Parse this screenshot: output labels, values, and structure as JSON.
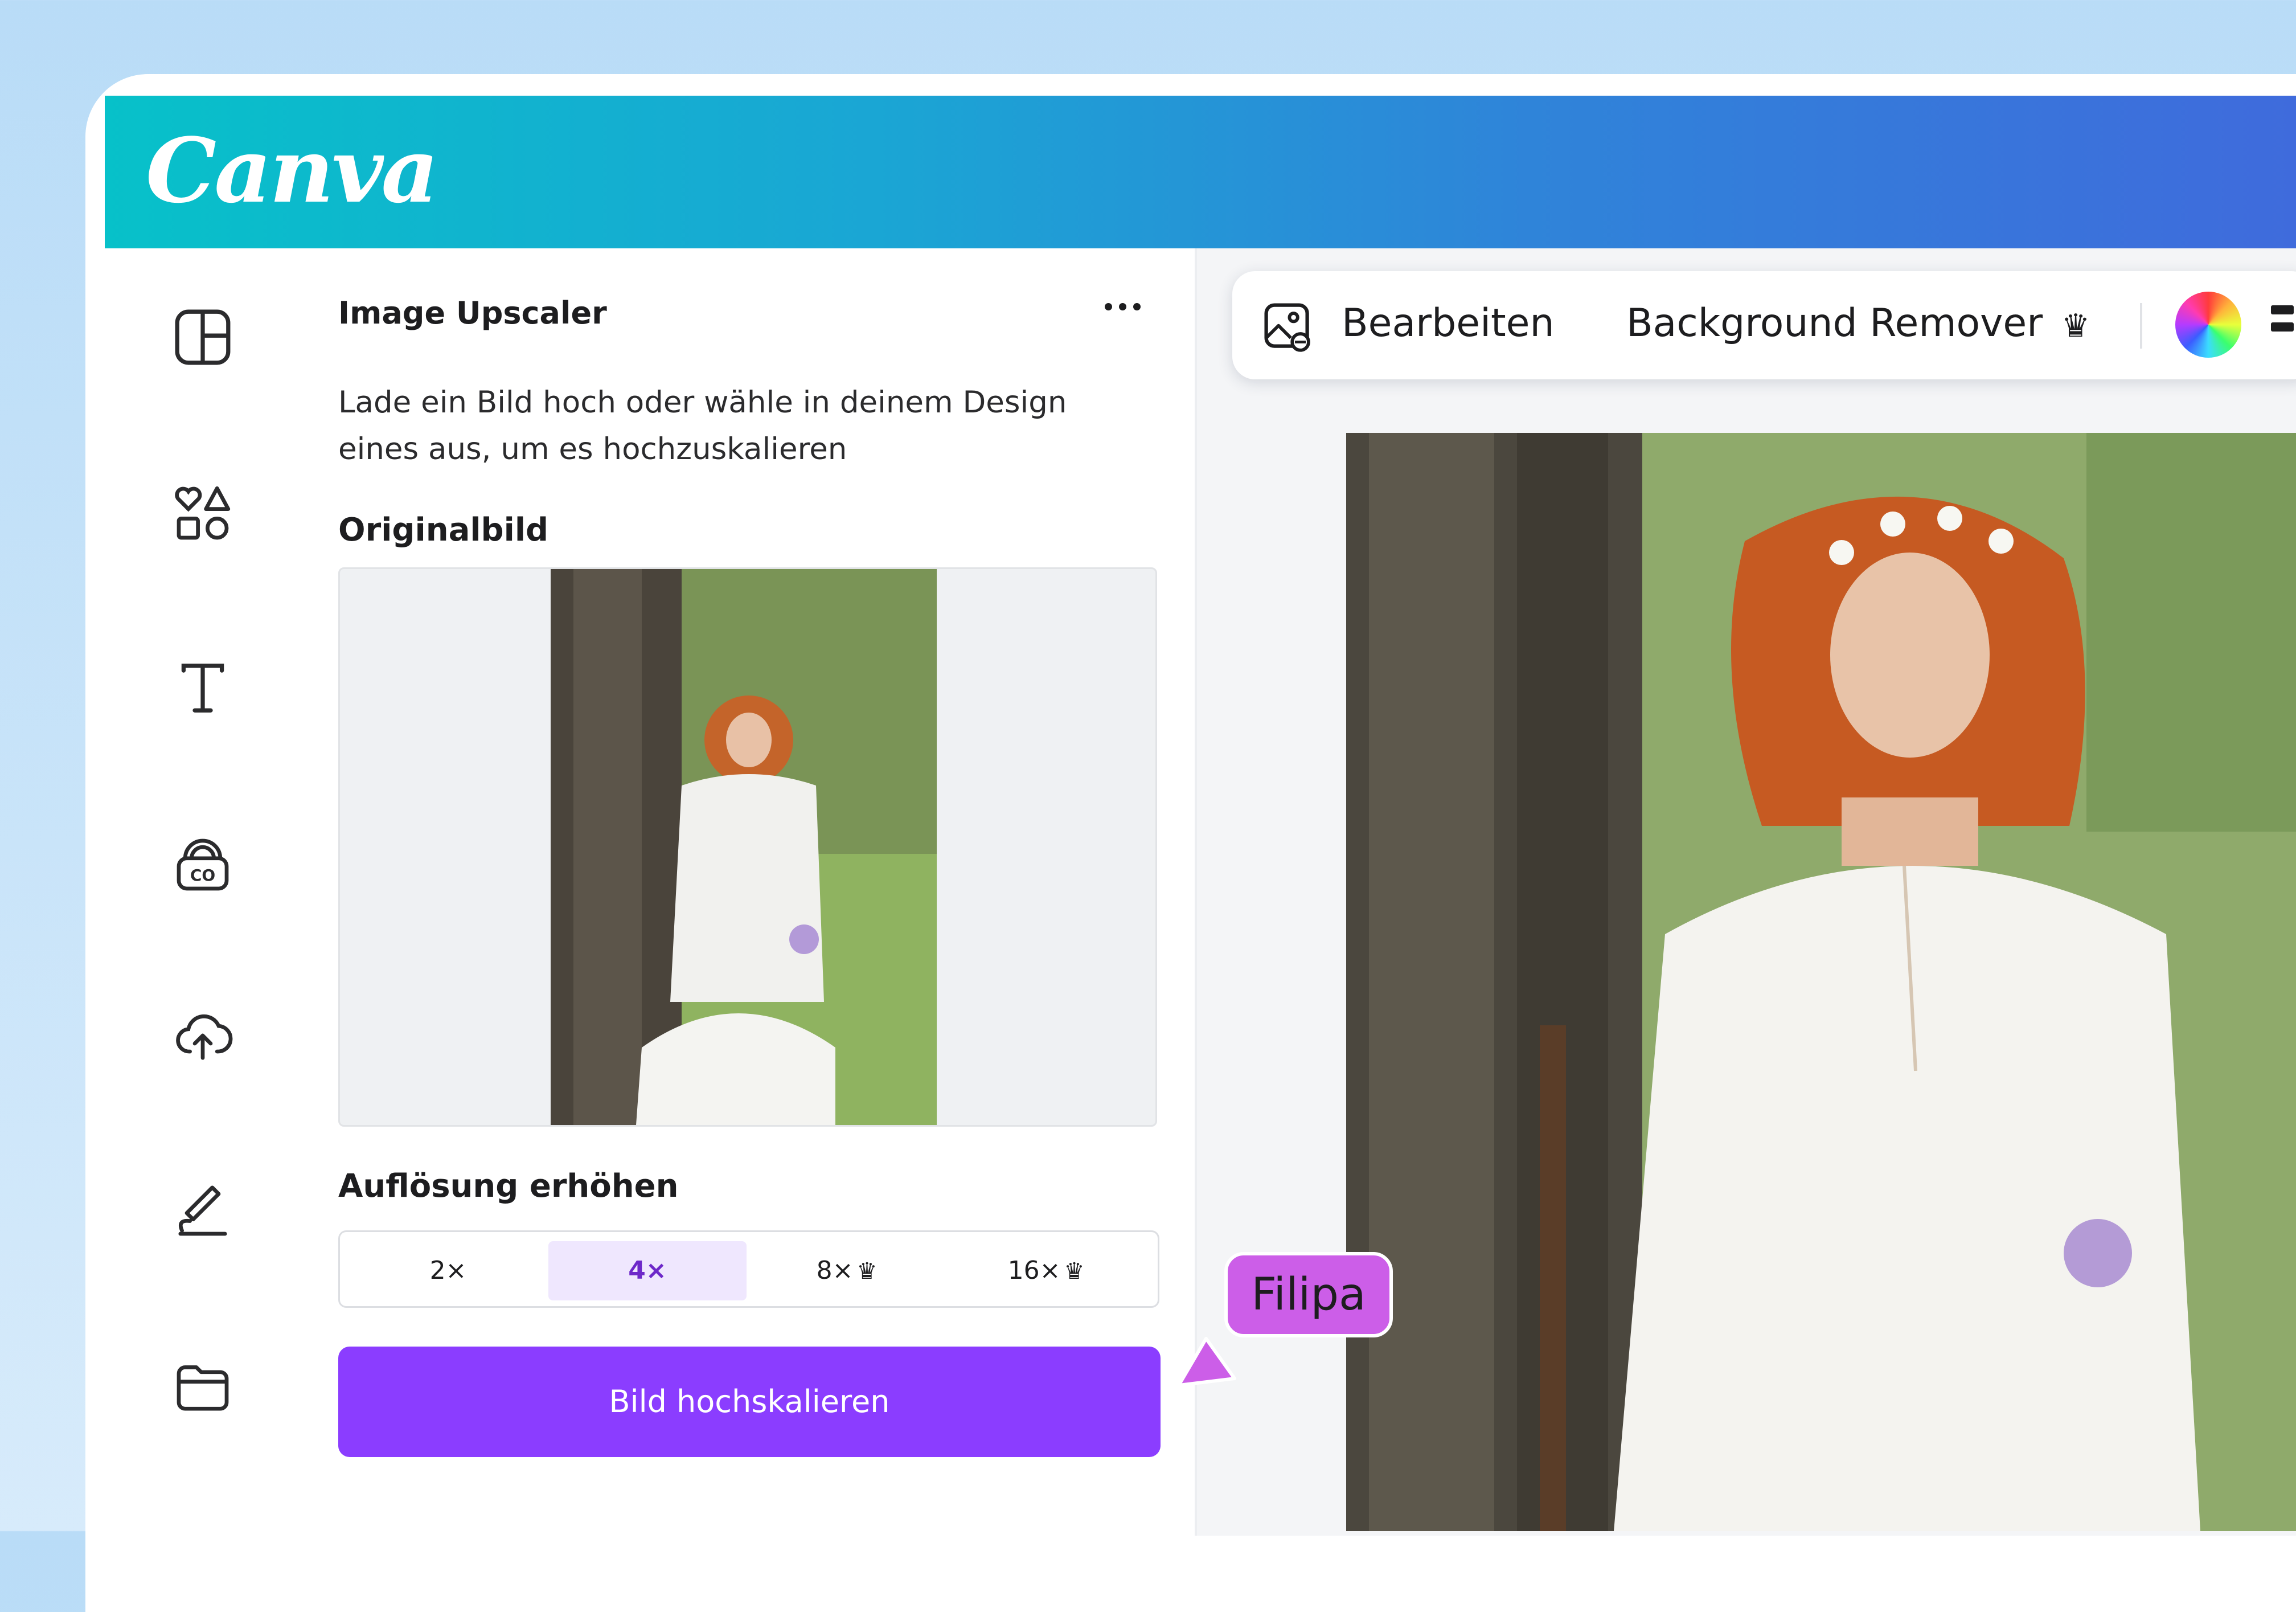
{
  "app": {
    "logo": "Canva"
  },
  "sidebar": {
    "items": [
      {
        "icon": "layout-icon"
      },
      {
        "icon": "elements-icon"
      },
      {
        "icon": "text-icon"
      },
      {
        "icon": "brand-icon"
      },
      {
        "icon": "uploads-icon"
      },
      {
        "icon": "draw-icon"
      },
      {
        "icon": "projects-icon"
      }
    ]
  },
  "panel": {
    "title": "Image Upscaler",
    "description": "Lade ein Bild hoch oder wähle in deinem Design eines aus, um es hochzuskalieren",
    "original_label": "Originalbild",
    "resolution_label": "Auflösung erhöhen",
    "options": [
      {
        "label": "2×",
        "active": false,
        "premium": false
      },
      {
        "label": "4×",
        "active": true,
        "premium": false
      },
      {
        "label": "8×",
        "active": false,
        "premium": true
      },
      {
        "label": "16×",
        "active": false,
        "premium": true
      }
    ],
    "upscale_button": "Bild hochskalieren"
  },
  "toolbar": {
    "edit_label": "Bearbeiten",
    "bg_remover_label": "Background Remover",
    "crown_glyph": "♛"
  },
  "collaborator": {
    "name": "Filipa",
    "color": "#cc5ee8"
  },
  "colors": {
    "accent": "#8b3dff",
    "header_start": "#07c1c9",
    "header_end": "#3f6bdc"
  }
}
